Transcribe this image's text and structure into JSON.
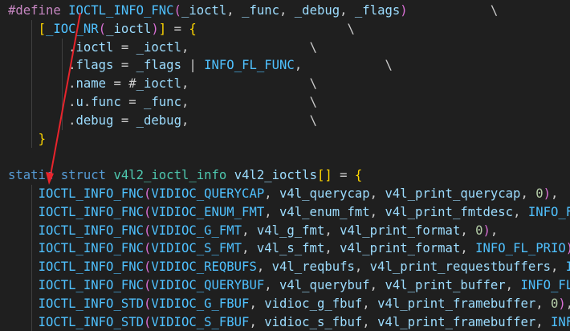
{
  "colors": {
    "background": "#1f1f1f",
    "default": "#cccccc",
    "keyword": "#569cd6",
    "preprocessor": "#c586c0",
    "macro": "#4fc1ff",
    "variable": "#9cdcfe",
    "member": "#9cdcfe",
    "type": "#4ec9b0",
    "function": "#dcdcaa",
    "number": "#b5cea8",
    "bracket1": "#ffd700",
    "bracket2": "#da70d6",
    "bracket3": "#179fff",
    "arrow": "#e8242c"
  },
  "lines": [
    [
      [
        "#define ",
        "preprocessor"
      ],
      [
        "IOCTL_INFO_FNC",
        "macro"
      ],
      [
        "(",
        "bracket2"
      ],
      [
        "_ioctl",
        "variable"
      ],
      [
        ", ",
        "default"
      ],
      [
        "_func",
        "variable"
      ],
      [
        ", ",
        "default"
      ],
      [
        "_debug",
        "variable"
      ],
      [
        ", ",
        "default"
      ],
      [
        "_flags",
        "variable"
      ],
      [
        ")",
        "bracket2"
      ],
      [
        "           \\",
        "default"
      ]
    ],
    [
      [
        "    ",
        "default"
      ],
      [
        "[",
        "bracket1"
      ],
      [
        "_IOC_NR",
        "macro"
      ],
      [
        "(",
        "bracket2"
      ],
      [
        "_ioctl",
        "variable"
      ],
      [
        ")",
        "bracket2"
      ],
      [
        "]",
        "bracket1"
      ],
      [
        " = ",
        "default"
      ],
      [
        "{",
        "bracket1"
      ],
      [
        "                    \\",
        "default"
      ]
    ],
    [
      [
        "        .",
        "default"
      ],
      [
        "ioctl",
        "member"
      ],
      [
        " = ",
        "default"
      ],
      [
        "_ioctl",
        "variable"
      ],
      [
        ",",
        "default"
      ],
      [
        "                \\",
        "default"
      ]
    ],
    [
      [
        "        .",
        "default"
      ],
      [
        "flags",
        "member"
      ],
      [
        " = ",
        "default"
      ],
      [
        "_flags",
        "variable"
      ],
      [
        " | ",
        "default"
      ],
      [
        "INFO_FL_FUNC",
        "macro"
      ],
      [
        ",",
        "default"
      ],
      [
        "           \\",
        "default"
      ]
    ],
    [
      [
        "        .",
        "default"
      ],
      [
        "name",
        "member"
      ],
      [
        " = ",
        "default"
      ],
      [
        "#",
        "default"
      ],
      [
        "_ioctl",
        "variable"
      ],
      [
        ",",
        "default"
      ],
      [
        "                \\",
        "default"
      ]
    ],
    [
      [
        "        .",
        "default"
      ],
      [
        "u",
        "member"
      ],
      [
        ".",
        "default"
      ],
      [
        "func",
        "member"
      ],
      [
        " = ",
        "default"
      ],
      [
        "_func",
        "variable"
      ],
      [
        ",",
        "default"
      ],
      [
        "                \\",
        "default"
      ]
    ],
    [
      [
        "        .",
        "default"
      ],
      [
        "debug",
        "member"
      ],
      [
        " = ",
        "default"
      ],
      [
        "_debug",
        "variable"
      ],
      [
        ",",
        "default"
      ],
      [
        "                \\",
        "default"
      ]
    ],
    [
      [
        "    ",
        "default"
      ],
      [
        "}",
        "bracket1"
      ]
    ],
    [],
    [
      [
        "static",
        "keyword"
      ],
      [
        " ",
        "default"
      ],
      [
        "struct",
        "keyword"
      ],
      [
        " ",
        "default"
      ],
      [
        "v4l2_ioctl_info",
        "type"
      ],
      [
        " ",
        "default"
      ],
      [
        "v4l2_ioctls",
        "variable"
      ],
      [
        "[]",
        "bracket1"
      ],
      [
        " = ",
        "default"
      ],
      [
        "{",
        "bracket1"
      ]
    ],
    [
      [
        "    ",
        "default"
      ],
      [
        "IOCTL_INFO_FNC",
        "macro"
      ],
      [
        "(",
        "bracket2"
      ],
      [
        "VIDIOC_QUERYCAP",
        "macro"
      ],
      [
        ", ",
        "default"
      ],
      [
        "v4l_querycap",
        "variable"
      ],
      [
        ", ",
        "default"
      ],
      [
        "v4l_print_querycap",
        "variable"
      ],
      [
        ", ",
        "default"
      ],
      [
        "0",
        "number"
      ],
      [
        ")",
        "bracket2"
      ],
      [
        ",",
        "default"
      ]
    ],
    [
      [
        "    ",
        "default"
      ],
      [
        "IOCTL_INFO_FNC",
        "macro"
      ],
      [
        "(",
        "bracket2"
      ],
      [
        "VIDIOC_ENUM_FMT",
        "macro"
      ],
      [
        ", ",
        "default"
      ],
      [
        "v4l_enum_fmt",
        "variable"
      ],
      [
        ", ",
        "default"
      ],
      [
        "v4l_print_fmtdesc",
        "variable"
      ],
      [
        ", ",
        "default"
      ],
      [
        "INFO_FL",
        "macro"
      ]
    ],
    [
      [
        "    ",
        "default"
      ],
      [
        "IOCTL_INFO_FNC",
        "macro"
      ],
      [
        "(",
        "bracket2"
      ],
      [
        "VIDIOC_G_FMT",
        "macro"
      ],
      [
        ", ",
        "default"
      ],
      [
        "v4l_g_fmt",
        "variable"
      ],
      [
        ", ",
        "default"
      ],
      [
        "v4l_print_format",
        "variable"
      ],
      [
        ", ",
        "default"
      ],
      [
        "0",
        "number"
      ],
      [
        ")",
        "bracket2"
      ],
      [
        ",",
        "default"
      ]
    ],
    [
      [
        "    ",
        "default"
      ],
      [
        "IOCTL_INFO_FNC",
        "macro"
      ],
      [
        "(",
        "bracket2"
      ],
      [
        "VIDIOC_S_FMT",
        "macro"
      ],
      [
        ", ",
        "default"
      ],
      [
        "v4l_s_fmt",
        "variable"
      ],
      [
        ", ",
        "default"
      ],
      [
        "v4l_print_format",
        "variable"
      ],
      [
        ", ",
        "default"
      ],
      [
        "INFO_FL_PRIO",
        "macro"
      ],
      [
        ")",
        "bracket2"
      ],
      [
        ",",
        "default"
      ]
    ],
    [
      [
        "    ",
        "default"
      ],
      [
        "IOCTL_INFO_FNC",
        "macro"
      ],
      [
        "(",
        "bracket2"
      ],
      [
        "VIDIOC_REQBUFS",
        "macro"
      ],
      [
        ", ",
        "default"
      ],
      [
        "v4l_reqbufs",
        "variable"
      ],
      [
        ", ",
        "default"
      ],
      [
        "v4l_print_requestbuffers",
        "variable"
      ],
      [
        ", ",
        "default"
      ],
      [
        "IN",
        "macro"
      ]
    ],
    [
      [
        "    ",
        "default"
      ],
      [
        "IOCTL_INFO_FNC",
        "macro"
      ],
      [
        "(",
        "bracket2"
      ],
      [
        "VIDIOC_QUERYBUF",
        "macro"
      ],
      [
        ", ",
        "default"
      ],
      [
        "v4l_querybuf",
        "variable"
      ],
      [
        ", ",
        "default"
      ],
      [
        "v4l_print_buffer",
        "variable"
      ],
      [
        ", ",
        "default"
      ],
      [
        "INFO_FL_",
        "macro"
      ]
    ],
    [
      [
        "    ",
        "default"
      ],
      [
        "IOCTL_INFO_STD",
        "macro"
      ],
      [
        "(",
        "bracket2"
      ],
      [
        "VIDIOC_G_FBUF",
        "macro"
      ],
      [
        ", ",
        "default"
      ],
      [
        "vidioc_g_fbuf",
        "variable"
      ],
      [
        ", ",
        "default"
      ],
      [
        "v4l_print_framebuffer",
        "variable"
      ],
      [
        ", ",
        "default"
      ],
      [
        "0",
        "number"
      ],
      [
        ")",
        "bracket2"
      ],
      [
        ",",
        "default"
      ]
    ],
    [
      [
        "    ",
        "default"
      ],
      [
        "IOCTL_INFO_STD",
        "macro"
      ],
      [
        "(",
        "bracket2"
      ],
      [
        "VIDIOC_S_FBUF",
        "macro"
      ],
      [
        ", ",
        "default"
      ],
      [
        "vidioc_s_fbuf",
        "variable"
      ],
      [
        ", ",
        "default"
      ],
      [
        "v4l_print_framebuffer",
        "variable"
      ],
      [
        ", ",
        "default"
      ],
      [
        "INFO",
        "macro"
      ]
    ]
  ]
}
